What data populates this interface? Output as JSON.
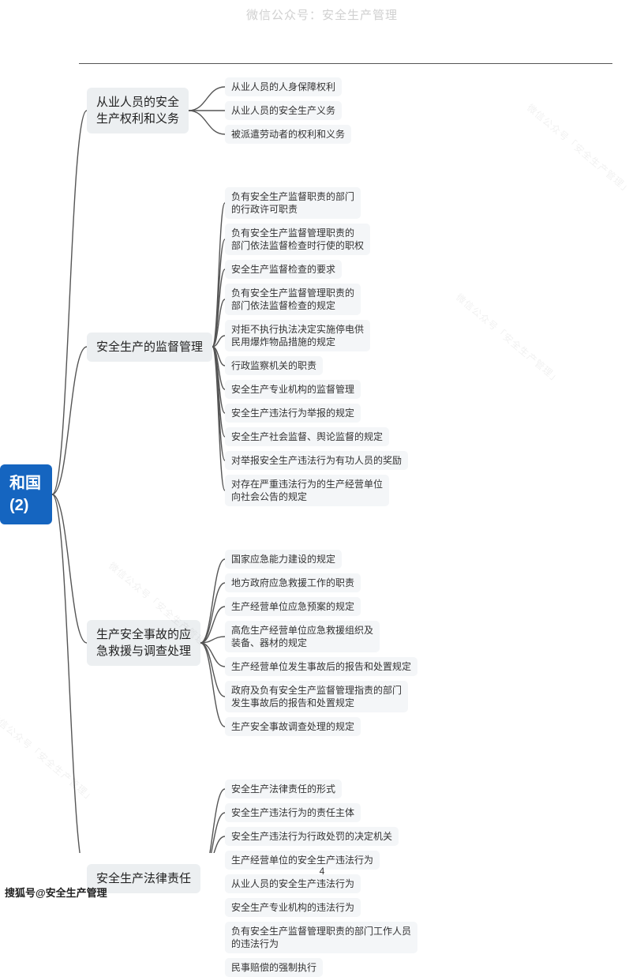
{
  "header": "微信公众号：安全生产管理",
  "pageNumber": "4",
  "footerSource": "搜狐号@安全生产管理",
  "watermarkText": "微信公众号「安全生产管理」",
  "root": {
    "label": "和国\n(2)"
  },
  "branches": [
    {
      "id": "b1",
      "label": "从业人员的安全\n生产权利和义务",
      "leaves": [
        "从业人员的人身保障权利",
        "从业人员的安全生产义务",
        "被派遣劳动者的权利和义务"
      ]
    },
    {
      "id": "b2",
      "label": "安全生产的监督管理",
      "leaves": [
        "负有安全生产监督职责的部门\n的行政许可职责",
        "负有安全生产监督管理职责的\n部门依法监督检查时行使的职权",
        "安全生产监督检查的要求",
        "负有安全生产监督管理职责的\n部门依法监督检查的规定",
        "对拒不执行执法决定实施停电供\n民用爆炸物品措施的规定",
        "行政监察机关的职责",
        "安全生产专业机构的监督管理",
        "安全生产违法行为举报的规定",
        "安全生产社会监督、舆论监督的规定",
        "对举报安全生产违法行为有功人员的奖励",
        "对存在严重违法行为的生产经营单位\n向社会公告的规定"
      ]
    },
    {
      "id": "b3",
      "label": "生产安全事故的应\n急救援与调查处理",
      "leaves": [
        "国家应急能力建设的规定",
        "地方政府应急救援工作的职责",
        "生产经营单位应急预案的规定",
        "高危生产经营单位应急救援组织及\n装备、器材的规定",
        "生产经营单位发生事故后的报告和处置规定",
        "政府及负有安全生产监督管理指责的部门\n发生事故后的报告和处置规定",
        "生产安全事故调查处理的规定"
      ]
    },
    {
      "id": "b4",
      "label": "安全生产法律责任",
      "leaves": [
        "安全生产法律责任的形式",
        "安全生产违法行为的责任主体",
        "安全生产违法行为行政处罚的决定机关",
        "生产经营单位的安全生产违法行为",
        "从业人员的安全生产违法行为",
        "安全生产专业机构的违法行为",
        "负有安全生产监督管理职责的部门工作人员\n的违法行为",
        "民事赔偿的强制执行"
      ]
    }
  ],
  "chart_data": {
    "type": "tree",
    "title": "中华人民共和国安全生产法 (2) 思维导图",
    "root": "和国 (2)",
    "children": [
      {
        "name": "从业人员的安全生产权利和义务",
        "children": [
          "从业人员的人身保障权利",
          "从业人员的安全生产义务",
          "被派遣劳动者的权利和义务"
        ]
      },
      {
        "name": "安全生产的监督管理",
        "children": [
          "负有安全生产监督职责的部门的行政许可职责",
          "负有安全生产监督管理职责的部门依法监督检查时行使的职权",
          "安全生产监督检查的要求",
          "负有安全生产监督管理职责的部门依法监督检查的规定",
          "对拒不执行执法决定实施停电供民用爆炸物品措施的规定",
          "行政监察机关的职责",
          "安全生产专业机构的监督管理",
          "安全生产违法行为举报的规定",
          "安全生产社会监督、舆论监督的规定",
          "对举报安全生产违法行为有功人员的奖励",
          "对存在严重违法行为的生产经营单位向社会公告的规定"
        ]
      },
      {
        "name": "生产安全事故的应急救援与调查处理",
        "children": [
          "国家应急能力建设的规定",
          "地方政府应急救援工作的职责",
          "生产经营单位应急预案的规定",
          "高危生产经营单位应急救援组织及装备、器材的规定",
          "生产经营单位发生事故后的报告和处置规定",
          "政府及负有安全生产监督管理指责的部门发生事故后的报告和处置规定",
          "生产安全事故调查处理的规定"
        ]
      },
      {
        "name": "安全生产法律责任",
        "children": [
          "安全生产法律责任的形式",
          "安全生产违法行为的责任主体",
          "安全生产违法行为行政处罚的决定机关",
          "生产经营单位的安全生产违法行为",
          "从业人员的安全生产违法行为",
          "安全生产专业机构的违法行为",
          "负有安全生产监督管理职责的部门工作人员的违法行为",
          "民事赔偿的强制执行"
        ]
      }
    ]
  }
}
